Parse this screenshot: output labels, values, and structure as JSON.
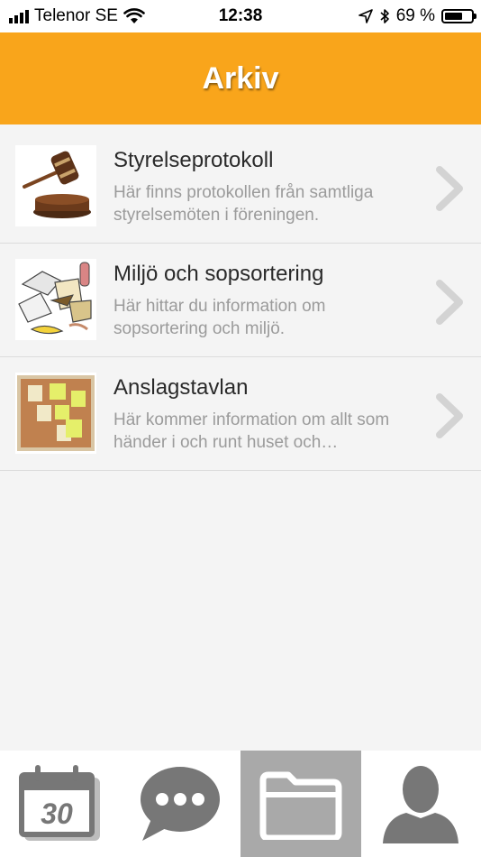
{
  "status_bar": {
    "carrier": "Telenor SE",
    "time": "12:38",
    "battery_percent": "69 %",
    "battery_level": 0.69
  },
  "header": {
    "title": "Arkiv"
  },
  "items": [
    {
      "title": "Styrelseprotokoll",
      "description": "Här finns protokollen från samtliga styrelsemöten i föreningen.",
      "icon": "gavel-image"
    },
    {
      "title": "Miljö och sopsortering",
      "description": "Här hittar du information om sopsortering och miljö.",
      "icon": "waste-image"
    },
    {
      "title": "Anslagstavlan",
      "description": "Här kommer information om allt som händer i och runt huset och…",
      "icon": "corkboard-image"
    }
  ],
  "tab_bar": {
    "calendar_day": "30",
    "active_tab": "archive",
    "tabs": [
      "calendar-icon",
      "chat-icon",
      "folder-icon",
      "profile-icon"
    ]
  },
  "colors": {
    "header_bg": "#f9a51b",
    "tab_active_bg": "#a9a9a9",
    "icon_gray": "#777777"
  }
}
